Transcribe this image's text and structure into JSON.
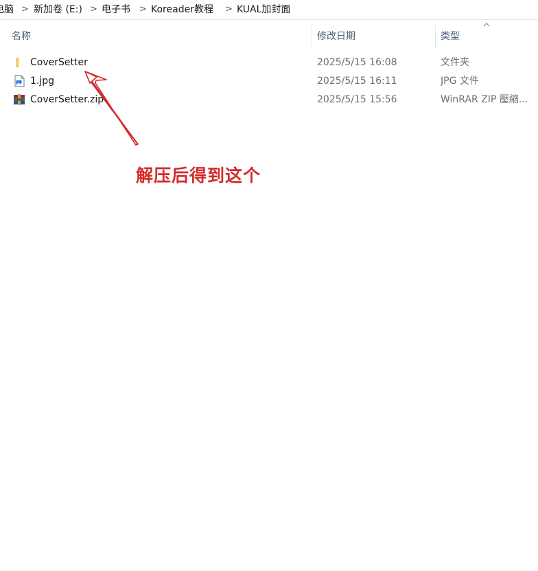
{
  "breadcrumb": {
    "items": [
      "电脑",
      "新加卷 (E:)",
      "电子书",
      "Koreader教程",
      "KUAL加封面"
    ],
    "separator": ">"
  },
  "columns": {
    "name": "名称",
    "date": "修改日期",
    "type": "类型",
    "sort_icon": "chevron-up-icon"
  },
  "files": [
    {
      "name": "CoverSetter",
      "date": "2025/5/15 16:08",
      "type": "文件夹",
      "icon": "folder-icon"
    },
    {
      "name": "1.jpg",
      "date": "2025/5/15 16:11",
      "type": "JPG 文件",
      "icon": "image-file-icon"
    },
    {
      "name": "CoverSetter.zip",
      "date": "2025/5/15 15:56",
      "type": "WinRAR ZIP 壓縮...",
      "icon": "winrar-archive-icon"
    }
  ],
  "annotation": {
    "text": "解压后得到这个",
    "color": "#d42a2a"
  },
  "colors": {
    "header_text": "#4c607a",
    "secondary_text": "#6d6d6d",
    "folder": "#f0c34a",
    "accent_red": "#d42a2a"
  }
}
